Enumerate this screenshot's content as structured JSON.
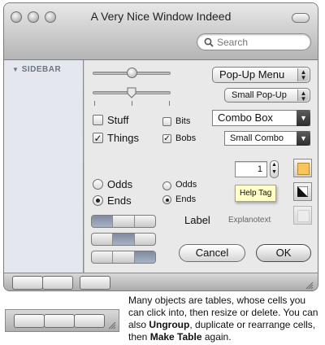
{
  "window": {
    "title": "A Very Nice Window Indeed"
  },
  "search": {
    "placeholder": "Search"
  },
  "sidebar": {
    "header": "SIDEBAR"
  },
  "popups": {
    "popup_menu": "Pop-Up Menu",
    "small_popup": "Small Pop-Up"
  },
  "combos": {
    "combo_box": "Combo Box",
    "small_combo": "Small Combo"
  },
  "checkboxes": {
    "stuff": {
      "label": "Stuff",
      "checked": false
    },
    "things": {
      "label": "Things",
      "checked": true
    },
    "bits": {
      "label": "Bits",
      "checked": false
    },
    "bobs": {
      "label": "Bobs",
      "checked": true
    }
  },
  "radios": {
    "group1": {
      "odds": "Odds",
      "ends": "Ends",
      "selected": "ends"
    },
    "group2": {
      "odds": "Odds",
      "ends": "Ends",
      "selected": "ends"
    }
  },
  "stepper_field": {
    "value": "1"
  },
  "tooltip": {
    "text": "Help Tag"
  },
  "labels": {
    "label": "Label",
    "explanotext": "Explanotext"
  },
  "buttons": {
    "cancel": "Cancel",
    "ok": "OK"
  },
  "colors": {
    "swatch_orange": "#fcc45a",
    "window_bg": "#d2d2d2",
    "sidebar_bg": "#e4e8ee"
  },
  "note": {
    "part1": "Many objects are tables, whose cells you can click into, then resize or delete. You can also ",
    "bold1": "Ungroup",
    "part2": ", duplicate or rearrange cells, then ",
    "bold2": "Make Table",
    "part3": " again."
  }
}
